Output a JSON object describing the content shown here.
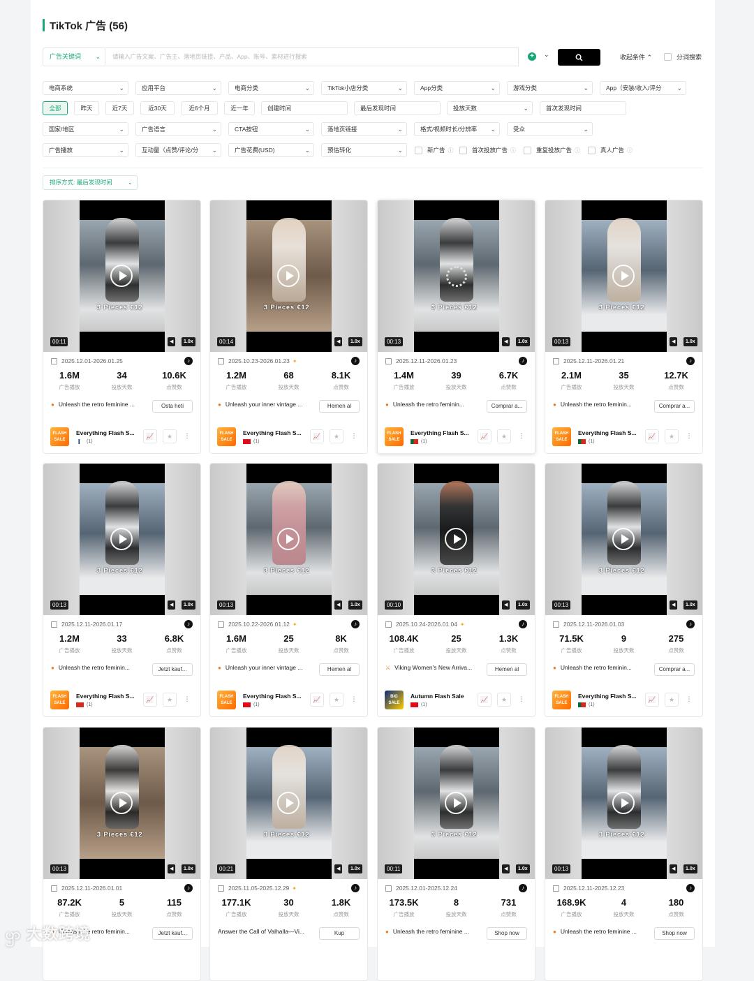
{
  "header": {
    "title": "TikTok 广告 (56)"
  },
  "search": {
    "keyword_type": "广告关键词",
    "placeholder": "请输入广告文案、广告主、落地页链接、产品、App、账号、素材进行搜索",
    "collapse_label": "收起条件",
    "segment_label": "分词搜索"
  },
  "filters_row1": [
    "电商系统",
    "应用平台",
    "电商分类",
    "TikTok小店分类",
    "App分类",
    "游戏分类",
    "App（安装/收入/评分"
  ],
  "time_chips": [
    "全部",
    "昨天",
    "近7天",
    "近30天",
    "近6个月",
    "近一年"
  ],
  "time_fields": [
    "创建时间",
    "最后发现时间",
    "投放天数",
    "首次发现时间"
  ],
  "filters_row3": [
    "国家/地区",
    "广告语言",
    "CTA按钮",
    "落地页链接",
    "格式/视频时长/分辨率",
    "受众"
  ],
  "filters_row4": [
    "广告播放",
    "互动量（点赞/评论/分",
    "广告花费(USD)",
    "预估转化"
  ],
  "checks": [
    "新广告",
    "首次投放广告",
    "重复投放广告",
    "真人广告"
  ],
  "sort_label": "排序方式: 最后发现时间",
  "stat_labels": {
    "plays": "广告播放",
    "days": "投放天数",
    "likes": "点赞数"
  },
  "pieces_text": "3 Pieces €12",
  "colors": {
    "accent": "#1aa776",
    "flame": "#f07a1a"
  },
  "cards": [
    {
      "duration": "00:11",
      "date": "2025.12.01-2026.01.25",
      "plays": "1.6M",
      "days": "34",
      "likes": "10.6K",
      "desc": "Unleash the retro feminine ...",
      "cta": "Osta heti",
      "advertiser": "Everything Flash S...",
      "count": "(1)",
      "video_text": "",
      "style": "s1",
      "figure": "",
      "spark": "",
      "flag": "fi",
      "icon": "fire",
      "loading": false
    },
    {
      "duration": "00:14",
      "date": "2025.10.23-2026.01.23",
      "plays": "1.2M",
      "days": "68",
      "likes": "8.1K",
      "desc": "Unleash your inner vintage ...",
      "cta": "Hemen al",
      "advertiser": "Everything Flash S...",
      "count": "(1)",
      "video_text": "",
      "style": "s2",
      "figure": "light",
      "spark": "✦",
      "flag": "tr",
      "icon": "fire",
      "loading": false
    },
    {
      "duration": "00:13",
      "date": "2025.12.11-2026.01.23",
      "plays": "1.4M",
      "days": "39",
      "likes": "6.7K",
      "desc": "Unleash the retro feminin...",
      "cta": "Comprar a...",
      "advertiser": "Everything Flash S...",
      "count": "(1)",
      "video_text": "",
      "style": "s1",
      "figure": "",
      "spark": "",
      "flag": "pt",
      "icon": "fire",
      "loading": true
    },
    {
      "duration": "00:13",
      "date": "2025.12.11-2026.01.21",
      "plays": "2.1M",
      "days": "35",
      "likes": "12.7K",
      "desc": "Unleash the retro feminin...",
      "cta": "Comprar a...",
      "advertiser": "Everything Flash S...",
      "count": "(1)",
      "video_text": "",
      "style": "s3",
      "figure": "light",
      "spark": "",
      "flag": "pt",
      "icon": "fire",
      "loading": false
    },
    {
      "duration": "00:13",
      "date": "2025.12.11-2026.01.17",
      "plays": "1.2M",
      "days": "33",
      "likes": "6.8K",
      "desc": "Unleash the retro feminin...",
      "cta": "Jetzt kauf...",
      "advertiser": "Everything Flash S...",
      "count": "(1)",
      "video_text": "",
      "style": "s3",
      "figure": "",
      "spark": "",
      "flag": "ch",
      "icon": "fire",
      "loading": false
    },
    {
      "duration": "00:13",
      "date": "2025.10.22-2026.01.12",
      "plays": "1.6M",
      "days": "25",
      "likes": "8K",
      "desc": "Unleash your inner vintage ...",
      "cta": "Hemen al",
      "advertiser": "Everything Flash S...",
      "count": "(1)",
      "video_text": "",
      "style": "s1",
      "figure": "pink",
      "spark": "✦",
      "flag": "tr",
      "icon": "fire",
      "loading": false
    },
    {
      "duration": "00:10",
      "date": "2025.10.24-2026.01.04",
      "plays": "108.4K",
      "days": "25",
      "likes": "1.3K",
      "desc": "Viking Women's New Arriva...",
      "cta": "Hemen al",
      "advertiser": "Autumn Flash Sale",
      "count": "(1)",
      "video_text": "",
      "style": "s1",
      "figure": "dark",
      "spark": "✦",
      "flag": "tr",
      "icon": "sword",
      "loading": false
    },
    {
      "duration": "00:13",
      "date": "2025.12.11-2026.01.03",
      "plays": "71.5K",
      "days": "9",
      "likes": "275",
      "desc": "Unleash the retro feminin...",
      "cta": "Comprar a...",
      "advertiser": "Everything Flash S...",
      "count": "(1)",
      "video_text": "",
      "style": "s3",
      "figure": "",
      "spark": "",
      "flag": "pt",
      "icon": "fire",
      "loading": false
    },
    {
      "duration": "00:13",
      "date": "2025.12.11-2026.01.01",
      "plays": "87.2K",
      "days": "5",
      "likes": "115",
      "desc": "Unleash the retro feminin...",
      "cta": "Jetzt kauf...",
      "advertiser": "",
      "count": "",
      "video_text": "",
      "style": "s2",
      "figure": "",
      "spark": "",
      "flag": "",
      "icon": "fire",
      "loading": false
    },
    {
      "duration": "00:21",
      "date": "2025.11.05-2025.12.29",
      "plays": "177.1K",
      "days": "30",
      "likes": "1.8K",
      "desc": "Answer the Call of Valhalla—Vi...",
      "cta": "Kup",
      "advertiser": "",
      "count": "",
      "video_text": "",
      "style": "s3",
      "figure": "light",
      "spark": "✦",
      "flag": "",
      "icon": "",
      "loading": false
    },
    {
      "duration": "00:11",
      "date": "2025.12.01-2025.12.24",
      "plays": "173.5K",
      "days": "8",
      "likes": "731",
      "desc": "Unleash the retro feminine ...",
      "cta": "Shop now",
      "advertiser": "",
      "count": "",
      "video_text": "",
      "style": "s1",
      "figure": "",
      "spark": "",
      "flag": "",
      "icon": "fire",
      "loading": false
    },
    {
      "duration": "00:13",
      "date": "2025.12.11-2025.12.23",
      "plays": "168.9K",
      "days": "4",
      "likes": "180",
      "desc": "Unleash the retro feminine ...",
      "cta": "Shop now",
      "advertiser": "",
      "count": "",
      "video_text": "",
      "style": "s3",
      "figure": "",
      "spark": "",
      "flag": "",
      "icon": "fire",
      "loading": false
    }
  ],
  "watermark": "大数跨境"
}
